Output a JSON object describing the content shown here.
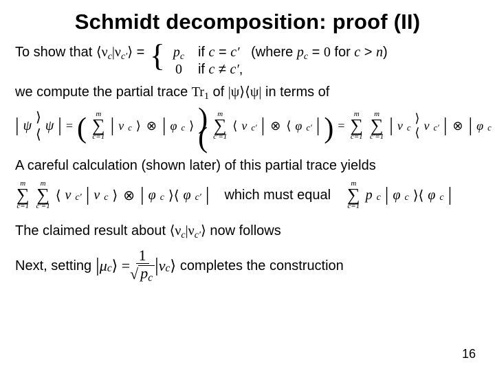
{
  "title": "Schmidt decomposition: proof (II)",
  "line1_prefix": "To show that ",
  "inner_product": "⟨ν",
  "inner_mid": "|ν",
  "inner_end": "⟩ = ",
  "case1_val": "p",
  "case1_cond_pre": "if ",
  "case1_cond_eq": " = ",
  "case1_where_pre": "   (where ",
  "case1_where_mid": " = 0 for ",
  "case1_where_end": ")",
  "case2_val": "0",
  "case2_cond": "if ",
  "case2_neq": " ≠ ",
  "case2_end": ",",
  "line2a": "we compute the partial trace ",
  "tr": "Tr",
  "line2b": " of |ψ⟩⟨ψ| in terms of",
  "sum_top": "m",
  "sum_bot1": "c=1",
  "sum_bot2": "c'=1",
  "line3": "A careful calculation (shown later) of this partial trace yields",
  "mid_text": "which must equal",
  "line4a": "The claimed result about ",
  "line4b": " now follows",
  "line5a": "Next, setting ",
  "line5b": " completes the construction",
  "page": "16"
}
